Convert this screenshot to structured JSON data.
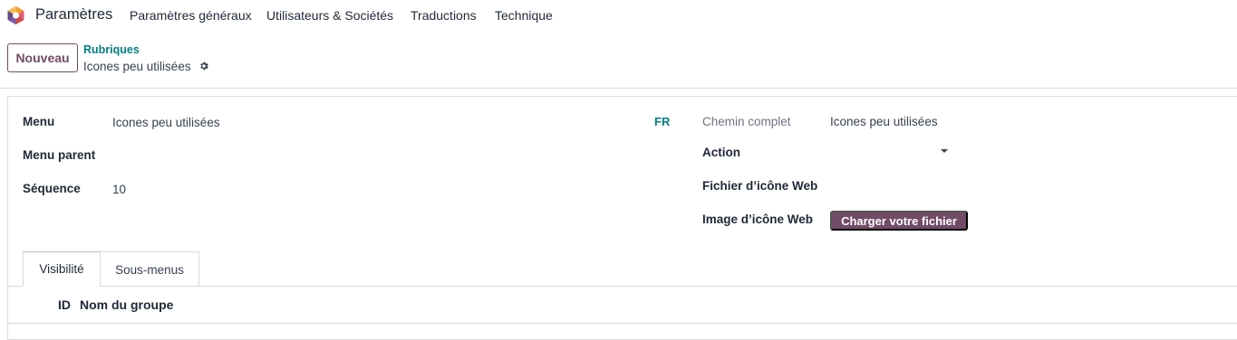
{
  "navbar": {
    "app_name": "Paramètres",
    "menu": [
      "Paramètres généraux",
      "Utilisateurs & Sociétés",
      "Traductions",
      "Technique"
    ]
  },
  "control_panel": {
    "new_button": "Nouveau",
    "breadcrumb_parent": "Rubriques",
    "breadcrumb_current": "Icones peu utilisées"
  },
  "form": {
    "left": {
      "menu_label": "Menu",
      "menu_value": "Icones peu utilisées",
      "parent_label": "Menu parent",
      "parent_value": "",
      "sequence_label": "Séquence",
      "sequence_value": "10"
    },
    "lang_badge": "FR",
    "right": {
      "full_path_label": "Chemin complet",
      "full_path_value": "Icones peu utilisées",
      "action_label": "Action",
      "action_value": "",
      "web_icon_file_label": "Fichier d’icône Web",
      "web_icon_image_label": "Image d’icône Web",
      "upload_button": "Charger votre fichier"
    }
  },
  "tabs": [
    {
      "label": "Visibilité",
      "active": true
    },
    {
      "label": "Sous-menus",
      "active": false
    }
  ],
  "table": {
    "columns": [
      "ID",
      "Nom du groupe"
    ]
  },
  "colors": {
    "brand": "#714b67",
    "link": "#017e84",
    "border": "#d8dadd"
  },
  "icons": {
    "logo": "odoo-app-logo-icon",
    "settings": "gear-icon",
    "dropdown": "caret-down-icon"
  }
}
